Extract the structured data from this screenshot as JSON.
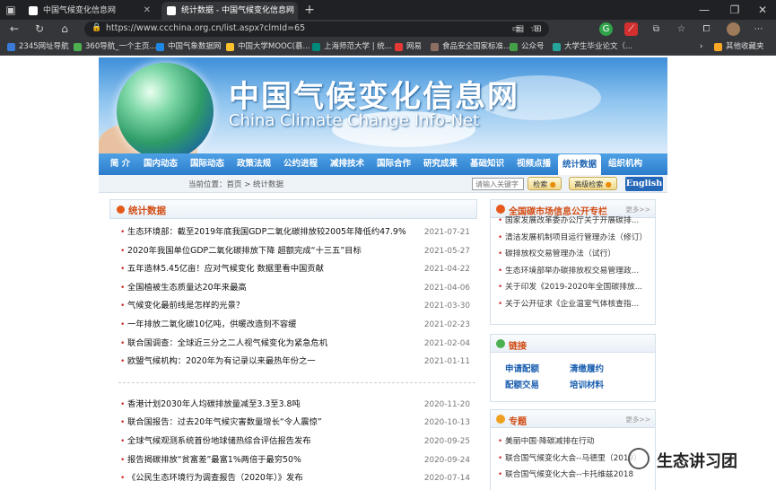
{
  "browser": {
    "tabs": [
      {
        "title": "中国气候变化信息网",
        "active": false
      },
      {
        "title": "统计数据 - 中国气候变化信息网",
        "active": true
      }
    ],
    "url": "https://www.ccchina.org.cn/list.aspx?clmId=65",
    "bookmarks": [
      {
        "label": "2345网址导航",
        "color": "#3b7bd8"
      },
      {
        "label": "360导航_一个主页...",
        "color": "#4caf50"
      },
      {
        "label": "中国气象数据网",
        "color": "#1e88e5"
      },
      {
        "label": "中国大学MOOC(慕...",
        "color": "#fbc02d"
      },
      {
        "label": "上海师范大学 | 统...",
        "color": "#00897b"
      },
      {
        "label": "网易",
        "color": "#e53935"
      },
      {
        "label": "食品安全国家标准...",
        "color": "#8d6e63"
      },
      {
        "label": "公众号",
        "color": "#43a047"
      },
      {
        "label": "大学生毕业论文（...",
        "color": "#26a69a"
      },
      {
        "label": "其他收藏夹",
        "color": "#f9a825"
      }
    ]
  },
  "site": {
    "title_cn": "中国气候变化信息网",
    "title_en": "China Climate Change Info-Net"
  },
  "nav": [
    "简 介",
    "国内动态",
    "国际动态",
    "政策法规",
    "公约进程",
    "减排技术",
    "国际合作",
    "研究成果",
    "基础知识",
    "视频点播",
    "统计数据",
    "组织机构"
  ],
  "nav_active": "统计数据",
  "subbar": {
    "breadcrumb": "当前位置：首页 > 统计数据",
    "search_placeholder": "请输入关键字",
    "search_label": "检索",
    "advanced_label": "高级检索",
    "english_label": "English"
  },
  "main": {
    "section_title": "统计数据",
    "group1": [
      {
        "title": "生态环境部：截至2019年底我国GDP二氧化碳排放较2005年降低约47.9%",
        "date": "2021-07-21"
      },
      {
        "title": "2020年我国单位GDP二氧化碳排放下降 超额完成“十三五”目标",
        "date": "2021-05-27"
      },
      {
        "title": "五年造林5.45亿亩！应对气候变化 数据里看中国贡献",
        "date": "2021-04-22"
      },
      {
        "title": "全国植被生态质量达20年来最高",
        "date": "2021-04-06"
      },
      {
        "title": "气候变化最前线是怎样的光景？",
        "date": "2021-03-30"
      },
      {
        "title": "一年排放二氧化碳10亿吨，供暖改造刻不容缓",
        "date": "2021-02-23"
      },
      {
        "title": "联合国调查：全球近三分之二人视气候变化为紧急危机",
        "date": "2021-02-04"
      },
      {
        "title": "欧盟气候机构：2020年为有记录以来最热年份之一",
        "date": "2021-01-11"
      }
    ],
    "group2": [
      {
        "title": "香港计划2030年人均碳排放量减至3.3至3.8吨",
        "date": "2020-11-20"
      },
      {
        "title": "联合国报告：过去20年气候灾害数量增长“令人震惊”",
        "date": "2020-10-13"
      },
      {
        "title": "全球气候观测系统首份地球储热综合评估报告发布",
        "date": "2020-09-25"
      },
      {
        "title": "报告揭碳排放“贫富差”最富1%两倍于最穷50%",
        "date": "2020-09-24"
      },
      {
        "title": "《公民生态环境行为调查报告（2020年）》发布",
        "date": "2020-07-14"
      }
    ]
  },
  "sidebar": {
    "carbon": {
      "title": "全国碳市场信息公开专栏",
      "more": "更多>>",
      "items": [
        "国家发展改革委办公厅关于开展碳排...",
        "清洁发展机制项目运行管理办法（修订）",
        "碳排放权交易管理办法（试行）",
        "生态环境部举办碳排放权交易管理政...",
        "关于印发《2019-2020年全国碳排放...",
        "关于公开征求《企业温室气体核查指..."
      ]
    },
    "links": {
      "title": "链接",
      "items": [
        "申请配额",
        "清缴履约",
        "配额交易",
        "培训材料"
      ]
    },
    "topics": {
      "title": "专题",
      "more": "更多>>",
      "items": [
        "美丽中国·降碳减排在行动",
        "联合国气候变化大会--马德里（2019）",
        "联合国气候变化大会--卡托维兹2018"
      ]
    }
  },
  "watermark": "生态讲习团"
}
